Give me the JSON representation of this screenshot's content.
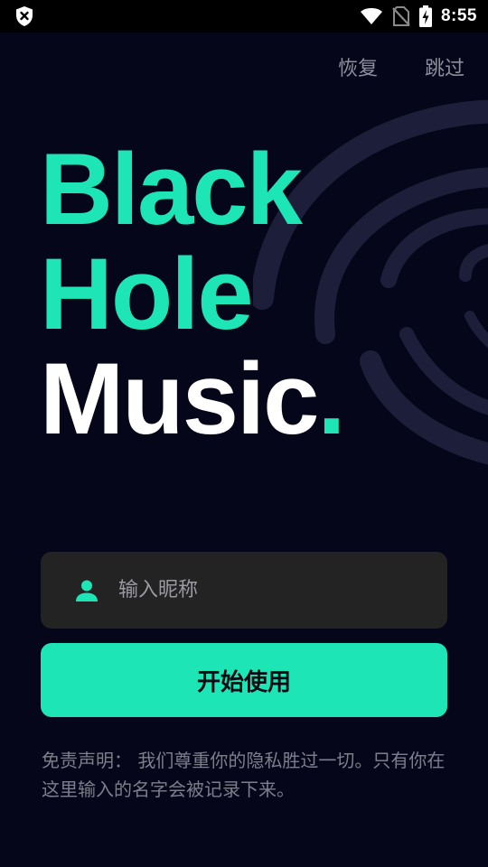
{
  "status_bar": {
    "time": "8:55",
    "icons": [
      "shield-x-icon",
      "wifi-icon",
      "no-sim-icon",
      "battery-charging-icon"
    ]
  },
  "top_links": {
    "restore": "恢复",
    "skip": "跳过"
  },
  "brand": {
    "line1": "Black",
    "line2": "Hole",
    "line3": "Music",
    "dot": "."
  },
  "nickname": {
    "placeholder": "输入昵称",
    "value": "",
    "icon": "person-icon"
  },
  "start_button": {
    "label": "开始使用"
  },
  "disclaimer": {
    "text": "免责声明： 我们尊重你的隐私胜过一切。只有你在这里输入的名字会被记录下来。"
  },
  "colors": {
    "accent": "#1de5b6",
    "background": "#06061a",
    "field_bg": "#232323",
    "muted_text": "#8d8f9c"
  }
}
